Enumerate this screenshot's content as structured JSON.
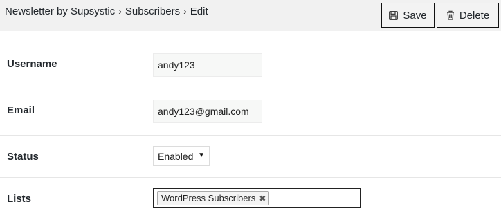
{
  "breadcrumb": {
    "items": [
      "Newsletter by Supsystic",
      "Subscribers",
      "Edit"
    ],
    "separator": "›"
  },
  "toolbar": {
    "save_label": "Save",
    "save_icon": "floppy-disk-icon",
    "delete_label": "Delete",
    "delete_icon": "trash-icon"
  },
  "form": {
    "username": {
      "label": "Username",
      "value": "andy123"
    },
    "email": {
      "label": "Email",
      "value": "andy123@gmail.com"
    },
    "status": {
      "label": "Status",
      "value": "Enabled"
    },
    "lists": {
      "label": "Lists",
      "tags": [
        "WordPress Subscribers"
      ],
      "remove_glyph": "✖"
    }
  }
}
